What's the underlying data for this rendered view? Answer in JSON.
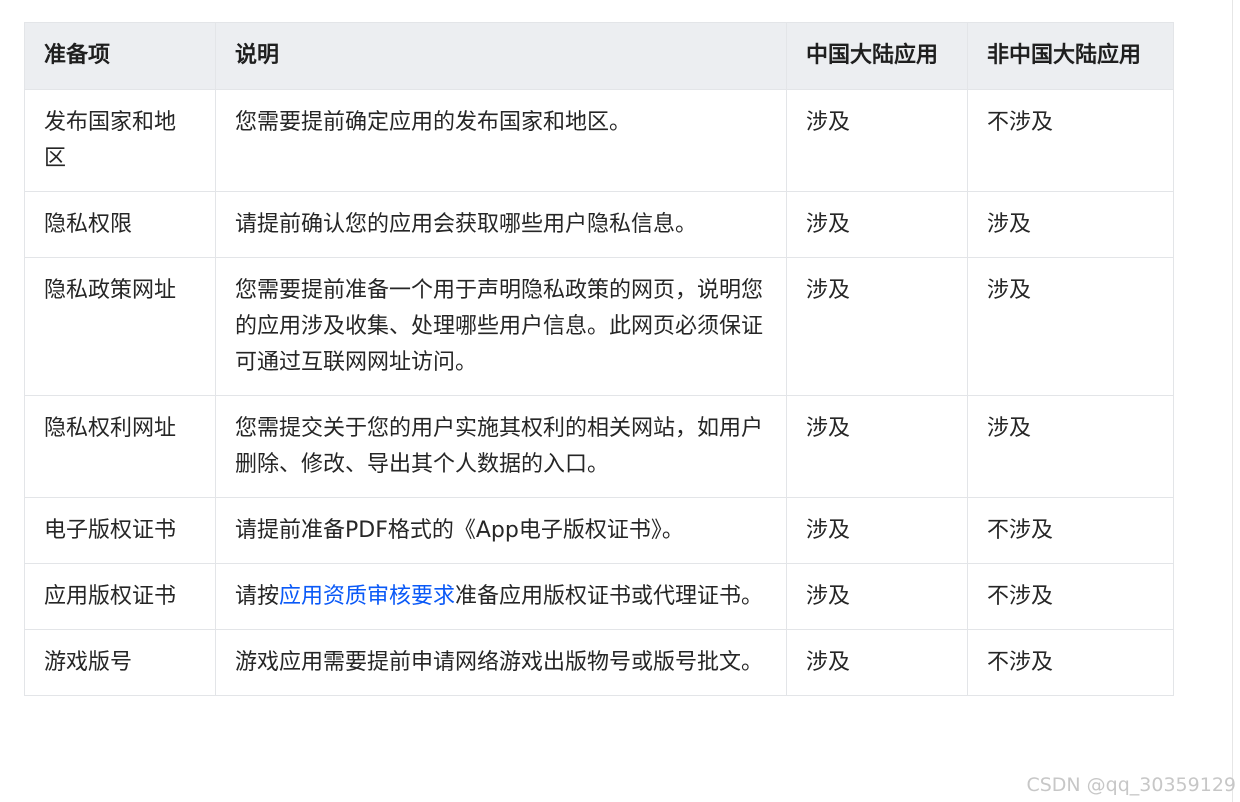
{
  "table": {
    "headers": [
      "准备项",
      "说明",
      "中国大陆应用",
      "非中国大陆应用"
    ],
    "rows": [
      {
        "item": "发布国家和地区",
        "desc_before": "您需要提前确定应用的发布国家和地区。",
        "desc_link": "",
        "desc_after": "",
        "cn": "涉及",
        "non_cn": "不涉及"
      },
      {
        "item": "隐私权限",
        "desc_before": "请提前确认您的应用会获取哪些用户隐私信息。",
        "desc_link": "",
        "desc_after": "",
        "cn": "涉及",
        "non_cn": "涉及"
      },
      {
        "item": "隐私政策网址",
        "desc_before": "您需要提前准备一个用于声明隐私政策的网页，说明您的应用涉及收集、处理哪些用户信息。此网页必须保证可通过互联网网址访问。",
        "desc_link": "",
        "desc_after": "",
        "cn": "涉及",
        "non_cn": "涉及"
      },
      {
        "item": "隐私权利网址",
        "desc_before": "您需提交关于您的用户实施其权利的相关网站，如用户删除、修改、导出其个人数据的入口。",
        "desc_link": "",
        "desc_after": "",
        "cn": "涉及",
        "non_cn": "涉及"
      },
      {
        "item": "电子版权证书",
        "desc_before": "请提前准备PDF格式的《App电子版权证书》。",
        "desc_link": "",
        "desc_after": "",
        "cn": "涉及",
        "non_cn": "不涉及"
      },
      {
        "item": "应用版权证书",
        "desc_before": "请按",
        "desc_link": "应用资质审核要求",
        "desc_after": "准备应用版权证书或代理证书。",
        "cn": "涉及",
        "non_cn": "不涉及"
      },
      {
        "item": "游戏版号",
        "desc_before": "游戏应用需要提前申请网络游戏出版物号或版号批文。",
        "desc_link": "",
        "desc_after": "",
        "cn": "涉及",
        "non_cn": "不涉及"
      }
    ]
  },
  "watermark": "CSDN @qq_30359129",
  "colors": {
    "header_bg": "#eceef1",
    "border": "#e3e5e8",
    "link": "#0a59f7",
    "text": "#262626"
  }
}
